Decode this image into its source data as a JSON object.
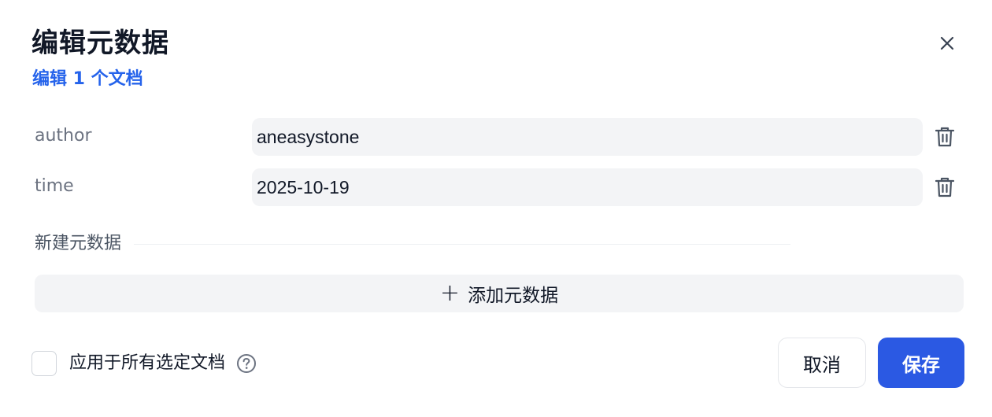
{
  "dialog": {
    "title": "编辑元数据",
    "subtitle": "编辑 1 个文档",
    "close_icon": "close-icon"
  },
  "metadata": [
    {
      "key": "author",
      "value": "aneasystone",
      "delete_icon": "trash-icon"
    },
    {
      "key": "time",
      "value": "2025-10-19",
      "delete_icon": "trash-icon"
    }
  ],
  "new_section": {
    "label": "新建元数据"
  },
  "add_button": {
    "icon": "plus-icon",
    "label": "添加元数据"
  },
  "apply_all": {
    "checked": false,
    "label": "应用于所有选定文档",
    "help_icon": "question-circle-icon"
  },
  "actions": {
    "cancel_label": "取消",
    "save_label": "保存"
  },
  "colors": {
    "accent": "#2b59e3",
    "subtitle": "#2563eb",
    "input_bg": "#f3f4f6",
    "muted_text": "#6b7280"
  }
}
